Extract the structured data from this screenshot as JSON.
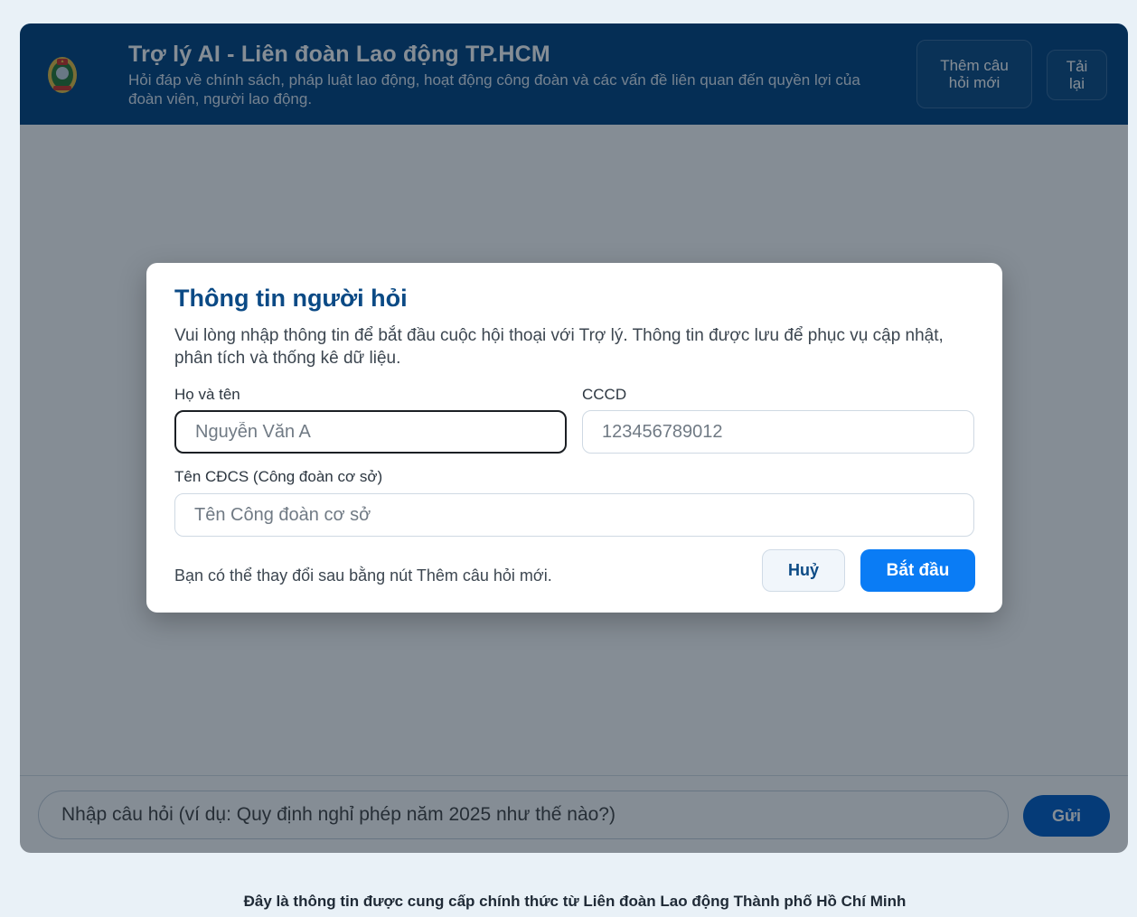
{
  "header": {
    "title": "Trợ lý AI - Liên đoàn Lao động TP.HCM",
    "subtitle": "Hỏi đáp về chính sách, pháp luật lao động, hoạt động công đoàn và các vấn đề liên quan đến quyền lợi của đoàn viên, người lao động.",
    "new_question_label": "Thêm câu hỏi mới",
    "reload_label": "Tải lại",
    "logo_icon": "union-emblem-icon"
  },
  "chat": {
    "input_placeholder": "Nhập câu hỏi (ví dụ: Quy định nghỉ phép năm 2025 như thế nào?)",
    "send_label": "Gửi"
  },
  "modal": {
    "title": "Thông tin người hỏi",
    "description": "Vui lòng nhập thông tin để bắt đầu cuộc hội thoại với Trợ lý. Thông tin được lưu để phục vụ cập nhật, phân tích và thống kê dữ liệu.",
    "name_label": "Họ và tên",
    "name_placeholder": "Nguyễn Văn A",
    "id_label": "CCCD",
    "id_placeholder": "123456789012",
    "union_label": "Tên CĐCS (Công đoàn cơ sở)",
    "union_placeholder": "Tên Công đoàn cơ sở",
    "note": "Bạn có thể thay đổi sau bằng nút Thêm câu hỏi mới.",
    "cancel_label": "Huỷ",
    "start_label": "Bắt đầu"
  },
  "footer": {
    "text": "Đây là thông tin được cung cấp chính thức từ Liên đoàn Lao động Thành phố Hồ Chí Minh"
  },
  "colors": {
    "header_bg": "#0b4a85",
    "primary_button": "#0a7cf5",
    "send_button": "#0b62c7"
  }
}
